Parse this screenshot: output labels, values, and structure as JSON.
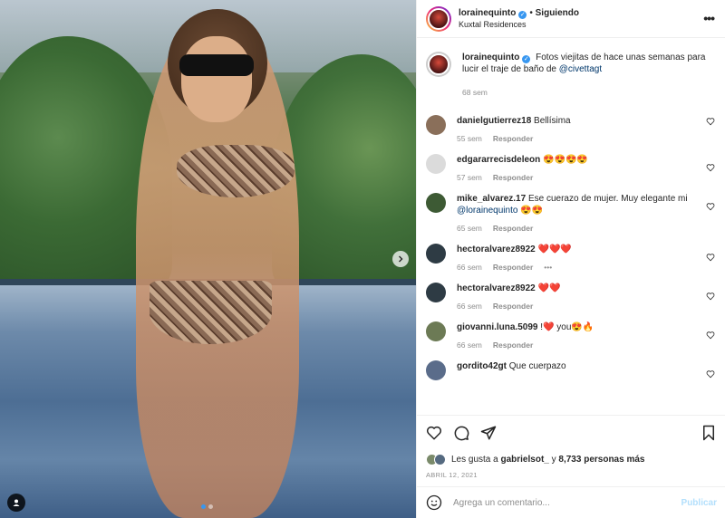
{
  "post": {
    "username": "lorainequinto",
    "follow_status": "Siguiendo",
    "separator": "•",
    "location": "Kuxtal Residences"
  },
  "caption": {
    "username": "lorainequinto",
    "text": "Fotos viejitas de hace unas semanas para lucir el traje de baño de ",
    "mention": "@civettagt",
    "time": "68 sem"
  },
  "comments": [
    {
      "user": "danielgutierrez18",
      "text": "Bellísima",
      "time": "55 sem",
      "reply": "Responder",
      "avatar_color": "#8a6f5a"
    },
    {
      "user": "edgararrecisdeleon",
      "text": "😍😍😍😍",
      "time": "57 sem",
      "reply": "Responder",
      "avatar_color": "#dbdbdb"
    },
    {
      "user": "mike_alvarez.17",
      "text": "Ese cuerazo de mujer. Muy elegante mi ",
      "mention": "@lorainequinto",
      "after": " 😍😍",
      "time": "65 sem",
      "reply": "Responder",
      "avatar_color": "#3d5a34"
    },
    {
      "user": "hectoralvarez8922",
      "text": "❤️❤️❤️",
      "time": "66 sem",
      "reply": "Responder",
      "more": "•••",
      "avatar_color": "#2e3b44"
    },
    {
      "user": "hectoralvarez8922",
      "text": "❤️❤️",
      "time": "66 sem",
      "reply": "Responder",
      "avatar_color": "#2e3b44"
    },
    {
      "user": "giovanni.luna.5099",
      "text": "!❤️ you😍🔥",
      "time": "66 sem",
      "reply": "Responder",
      "avatar_color": "#6c7a55"
    },
    {
      "user": "gordito42gt",
      "text": "Que cuerpazo",
      "avatar_color": "#5a6c8a"
    }
  ],
  "likes": {
    "prefix": "Les gusta a ",
    "user": "gabrielsot_",
    "middle": " y ",
    "count": "8,733 personas más"
  },
  "date": "ABRIL 12, 2021",
  "add_comment": {
    "placeholder": "Agrega un comentario...",
    "post_label": "Publicar"
  },
  "icons": [
    "emoji-icon",
    "heart-icon",
    "comment-icon",
    "share-icon",
    "bookmark-icon",
    "more-options-icon",
    "next-arrow-icon",
    "user-tag-icon"
  ],
  "colors": {
    "accent": "#3897f0",
    "link": "#00376b",
    "muted": "#8e8e8e",
    "like_red": "#ed4956"
  }
}
